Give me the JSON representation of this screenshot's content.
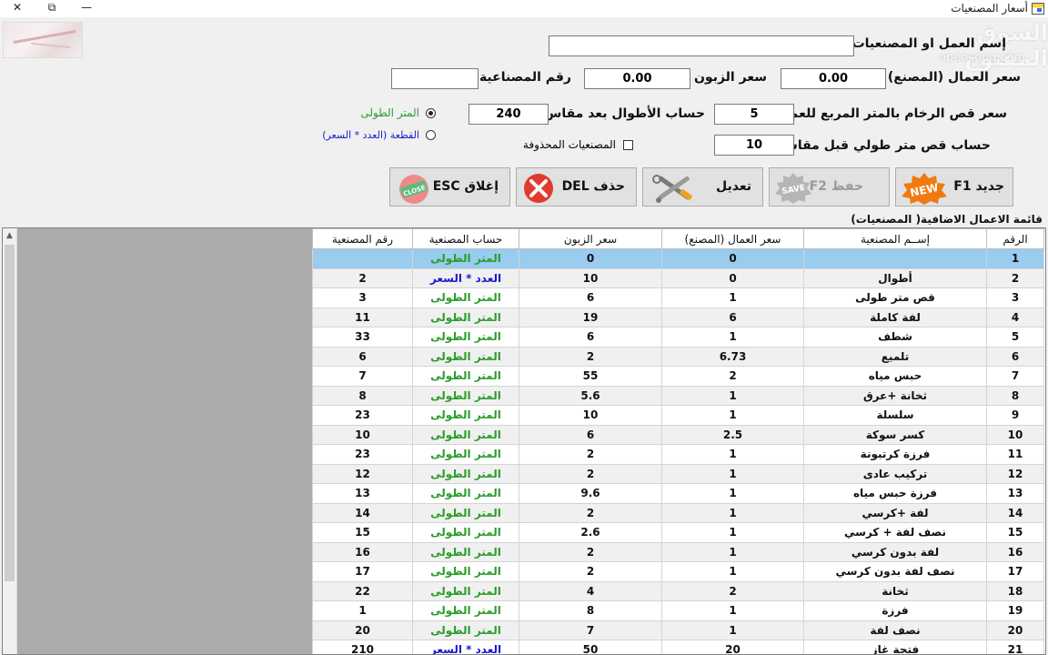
{
  "window": {
    "title": "أسعار المصنعيات",
    "minimize_glyph": "—",
    "maximize_glyph": "⧉",
    "close_glyph": "✕"
  },
  "watermark": {
    "arabic": "السوق المفتوح",
    "latin": "opensooq.com"
  },
  "form": {
    "name_label": "إسم العمل او المصنعيات",
    "name_value": "",
    "worker_price_label": "سعر العمال (المصنع)",
    "worker_price_value": "0.00",
    "customer_price_label": "سعر الزبون",
    "customer_price_value": "0.00",
    "craft_no_label": "رقم المصناعية",
    "craft_no_value": "",
    "marble_cut_label": "سعر قص الرخام بالمتر المربع للعمال",
    "marble_cut_value": "5",
    "lengths_label": "حساب  الأطوال بعد مقاس",
    "lengths_value": "240",
    "linear_cut_label": "حساب قص متر طولي قبل مقاس",
    "linear_cut_value": "10",
    "radio_linear_label": "المتر الطولى",
    "radio_piece_label": "القطعة (العدد * السعر)",
    "deleted_label": "المصنعيات المحذوفة"
  },
  "buttons": {
    "new_label": "جديد   F1",
    "save_label": "حفظ   F2",
    "edit_label": "تعديل",
    "delete_label": "حذف DEL",
    "close_label": "إغلاق  ESC"
  },
  "icons": {
    "new": "new-badge-icon",
    "save": "save-badge-icon",
    "edit": "tools-icon",
    "delete": "red-x-icon",
    "close": "close-sign-icon"
  },
  "grid": {
    "caption": "قائمة الاعمال الاضافية( المصنعيات)",
    "columns": [
      "الرقم",
      "إســم المصنعية",
      "سعر العمال (المصنع)",
      "سعر الزبون",
      "حساب المصنعية",
      "رقم المصنعية"
    ],
    "rows": [
      {
        "no": "1",
        "name": "",
        "worker": "0",
        "customer": "0",
        "calc": "المتر الطولى",
        "craft": ""
      },
      {
        "no": "2",
        "name": "أطوال",
        "worker": "0",
        "customer": "10",
        "calc": "العدد * السعر",
        "craft": "2"
      },
      {
        "no": "3",
        "name": "قص متر طولى",
        "worker": "1",
        "customer": "6",
        "calc": "المتر الطولى",
        "craft": "3"
      },
      {
        "no": "4",
        "name": "لفة كاملة",
        "worker": "6",
        "customer": "19",
        "calc": "المتر الطولى",
        "craft": "11"
      },
      {
        "no": "5",
        "name": "شطف",
        "worker": "1",
        "customer": "6",
        "calc": "المتر الطولى",
        "craft": "33"
      },
      {
        "no": "6",
        "name": "تلميع",
        "worker": "6.73",
        "customer": "2",
        "calc": "المتر الطولى",
        "craft": "6"
      },
      {
        "no": "7",
        "name": "حبس مياه",
        "worker": "2",
        "customer": "55",
        "calc": "المتر الطولى",
        "craft": "7"
      },
      {
        "no": "8",
        "name": "ثخانة +عرق",
        "worker": "1",
        "customer": "5.6",
        "calc": "المتر الطولى",
        "craft": "8"
      },
      {
        "no": "9",
        "name": "سلسلة",
        "worker": "1",
        "customer": "10",
        "calc": "المتر الطولى",
        "craft": "23"
      },
      {
        "no": "10",
        "name": "كسر سوكة",
        "worker": "2.5",
        "customer": "6",
        "calc": "المتر الطولى",
        "craft": "10"
      },
      {
        "no": "11",
        "name": "فرزة كرتبونة",
        "worker": "1",
        "customer": "2",
        "calc": "المتر الطولى",
        "craft": "23"
      },
      {
        "no": "12",
        "name": "تركيب عادى",
        "worker": "1",
        "customer": "2",
        "calc": "المتر الطولى",
        "craft": "12"
      },
      {
        "no": "13",
        "name": "فرزة حبس مياه",
        "worker": "1",
        "customer": "9.6",
        "calc": "المتر الطولى",
        "craft": "13"
      },
      {
        "no": "14",
        "name": "لفة +كرسي",
        "worker": "1",
        "customer": "2",
        "calc": "المتر الطولى",
        "craft": "14"
      },
      {
        "no": "15",
        "name": "نصف لفة + كرسي",
        "worker": "1",
        "customer": "2.6",
        "calc": "المتر الطولى",
        "craft": "15"
      },
      {
        "no": "16",
        "name": "لفة بدون كرسي",
        "worker": "1",
        "customer": "2",
        "calc": "المتر الطولى",
        "craft": "16"
      },
      {
        "no": "17",
        "name": "نصف لفة بدون كرسي",
        "worker": "1",
        "customer": "2",
        "calc": "المتر الطولى",
        "craft": "17"
      },
      {
        "no": "18",
        "name": "ثخانة",
        "worker": "2",
        "customer": "4",
        "calc": "المتر الطولى",
        "craft": "22"
      },
      {
        "no": "19",
        "name": "فرزة",
        "worker": "1",
        "customer": "8",
        "calc": "المتر الطولى",
        "craft": "1"
      },
      {
        "no": "20",
        "name": "نصف لفة",
        "worker": "1",
        "customer": "7",
        "calc": "المتر الطولى",
        "craft": "20"
      },
      {
        "no": "21",
        "name": "فتحة غاز",
        "worker": "20",
        "customer": "50",
        "calc": "العدد * السعر",
        "craft": "210"
      }
    ]
  },
  "colors": {
    "selected_row": "#99ccee",
    "calc_linear": "#2a9d2a",
    "calc_piece": "#1a1acc"
  }
}
